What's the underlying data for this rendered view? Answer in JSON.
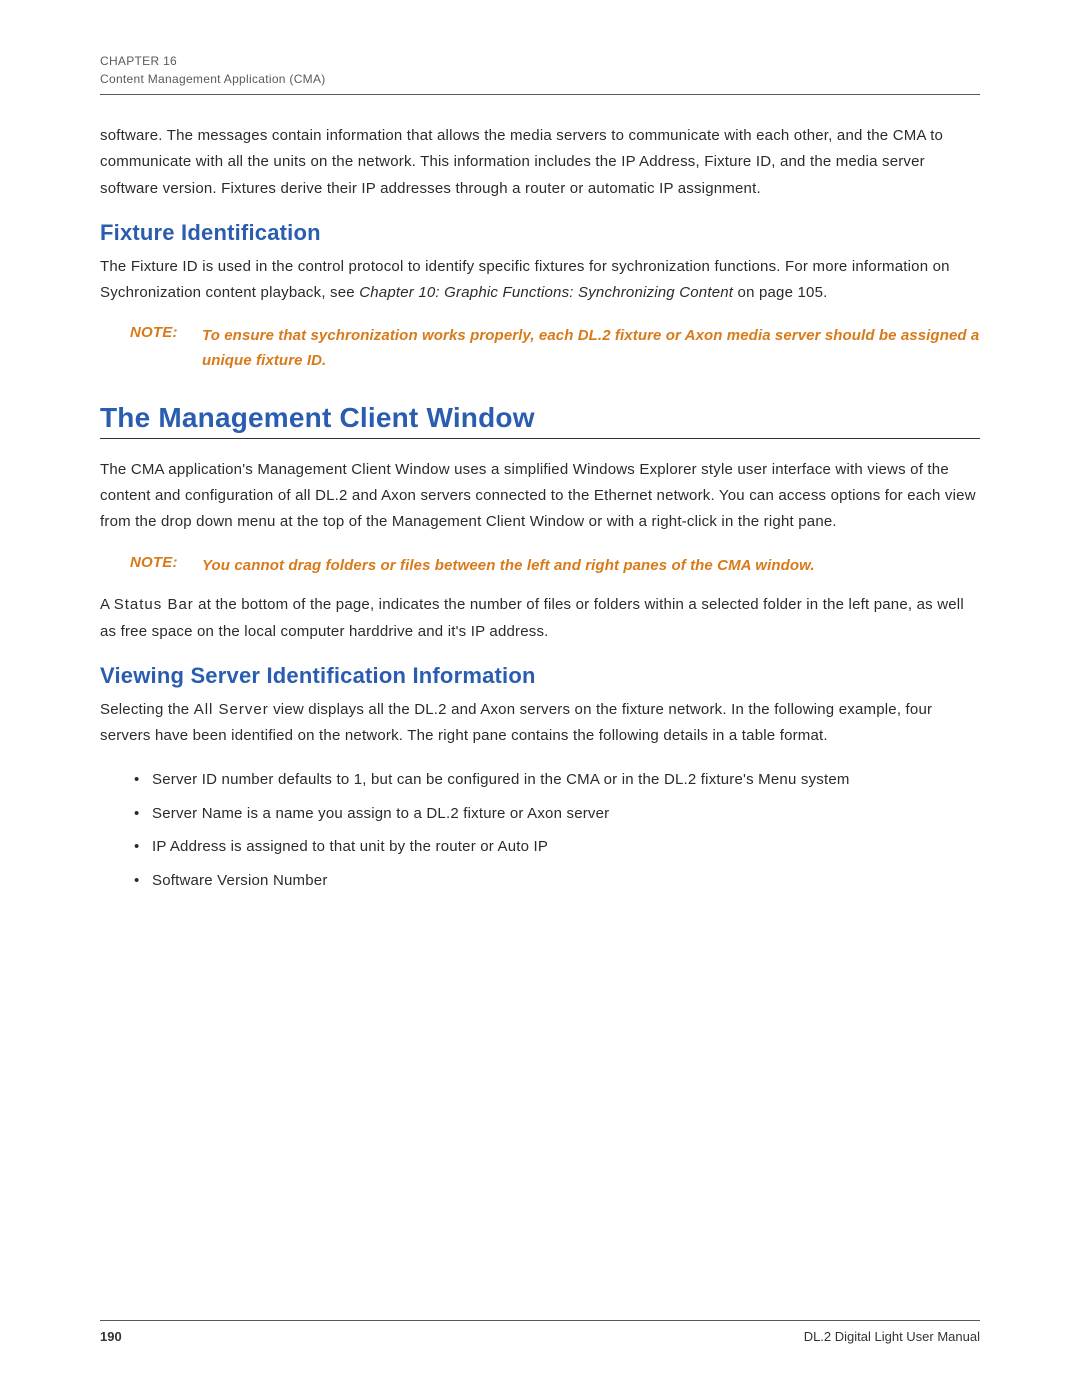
{
  "header": {
    "chapter": "CHAPTER 16",
    "title": "Content Management Application (CMA)"
  },
  "intro_para": "software. The messages contain information that allows the media servers to communicate with each other, and the CMA to communicate with all the units on the network. This information includes the IP Address, Fixture ID, and the media server software version. Fixtures derive their IP addresses through a router or automatic IP assignment.",
  "fixture_ident": {
    "heading": "Fixture Identification",
    "para_pre": "The Fixture ID is used in the control protocol to identify specific fixtures for sychronization functions. For more information on Sychronization content playback, see ",
    "para_link": "Chapter 10:  Graphic Functions: Synchronizing Content",
    "para_post": " on page 105.",
    "note_label": "NOTE:",
    "note_text": "To ensure that sychronization works properly, each DL.2 fixture or Axon media server should be assigned a unique fixture ID."
  },
  "mgmt_window": {
    "heading": "The Management Client Window",
    "para1": "The CMA application's Management Client Window uses a simplified Windows Explorer style user interface with views of the content and configuration of all DL.2 and Axon servers connected to the Ethernet network. You can access options for each view from the drop down menu at the top of the Management Client Window or with a right-click in the right pane.",
    "note_label": "NOTE:",
    "note_text": "You cannot drag folders or files between the left and right panes of the CMA window.",
    "para2_pre": "A ",
    "para2_term": "Status Bar",
    "para2_post": " at the bottom of the page, indicates the number of files or folders within a selected folder in the left pane, as well as free space on the local computer harddrive and it's IP address."
  },
  "viewing": {
    "heading": "Viewing Server Identification Information",
    "para_pre": "Selecting the ",
    "para_term": "All Server",
    "para_post": " view displays all the DL.2 and Axon servers on the fixture network. In the following example, four servers have been identified on the network. The right pane contains the following details in a table format.",
    "bullets": [
      {
        "term": "Server ID",
        "rest": " number defaults to 1, but can be configured in the CMA or in the DL.2 fixture's Menu system"
      },
      {
        "term": "Server Name",
        "rest": " is a name you assign to a DL.2 fixture or Axon server"
      },
      {
        "term": "IP Address",
        "rest": " is assigned to that unit by the router or Auto IP"
      },
      {
        "term": "Software Version",
        "rest": " Number"
      }
    ]
  },
  "footer": {
    "page": "190",
    "manual": "DL.2 Digital Light User Manual"
  }
}
